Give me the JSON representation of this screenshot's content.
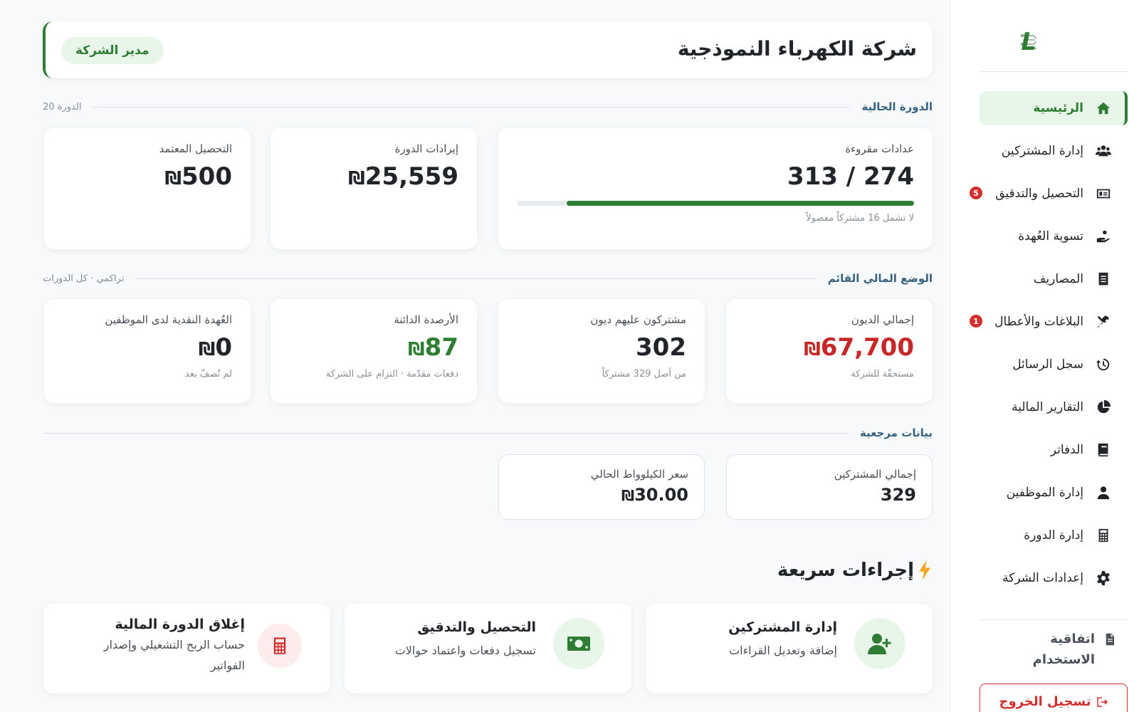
{
  "brand": {
    "logo_text": "PL"
  },
  "sidebar": {
    "items": [
      {
        "label": "الرئيسية",
        "icon": "home-icon",
        "active": true
      },
      {
        "label": "إدارة المشتركين",
        "icon": "users-icon"
      },
      {
        "label": "التحصيل والتدقيق",
        "icon": "money-card-icon",
        "badge": "5"
      },
      {
        "label": "تسوية العُهدة",
        "icon": "hand-coin-icon"
      },
      {
        "label": "المصاريف",
        "icon": "receipt-icon"
      },
      {
        "label": "البلاغات والأعطال",
        "icon": "tools-icon",
        "badge": "1"
      },
      {
        "label": "سجل الرسائل",
        "icon": "history-icon"
      },
      {
        "label": "التقارير المالية",
        "icon": "pie-chart-icon"
      },
      {
        "label": "الدفاتر",
        "icon": "book-icon"
      },
      {
        "label": "إدارة الموظفين",
        "icon": "user-tie-icon"
      },
      {
        "label": "إدارة الدورة",
        "icon": "calculator-icon"
      },
      {
        "label": "إعدادات الشركة",
        "icon": "gear-icon"
      }
    ],
    "terms_label": "اتفاقية الاستخدام",
    "logout_label": "تسجيل الخروج"
  },
  "header": {
    "company_name": "شركة الكهرباء النموذجية",
    "role": "مدير الشركة"
  },
  "current_cycle": {
    "title": "الدورة الحالية",
    "meta": "الدورة 20",
    "meters": {
      "label": "عدادات مقروءة",
      "value": "313 / 274",
      "progress": 0.875,
      "sub": "لا تشمل 16 مشتركاً مفصولاً"
    },
    "revenue": {
      "label": "إيرادات الدورة",
      "value": "25,559",
      "currency": "₪"
    },
    "approved": {
      "label": "التحصيل المعتمد",
      "value": "500",
      "currency": "₪"
    }
  },
  "financial": {
    "title": "الوضع المالي القائم",
    "meta": "تراكمي · كل الدورات",
    "debts": {
      "label": "إجمالي الديون",
      "value": "67,700",
      "currency": "₪",
      "sub": "مستحقّة للشركة"
    },
    "indebted": {
      "label": "مشتركون عليهم ديون",
      "value": "302",
      "sub": "من أصل 329 مشتركاً"
    },
    "credit": {
      "label": "الأرصدة الدائنة",
      "value": "87",
      "currency": "₪",
      "sub": "دفعات مقدّمة · التزام على الشركة"
    },
    "custody": {
      "label": "العُهدة النقدية لدى الموظفين",
      "value": "0",
      "currency": "₪",
      "sub": "لم تُصفّ بعد"
    }
  },
  "reference": {
    "title": "بيانات مرجعية",
    "subscribers": {
      "label": "إجمالي المشتركين",
      "value": "329"
    },
    "kwh": {
      "label": "سعر الكيلوواط الحالي",
      "value": "30.00",
      "currency": "₪"
    }
  },
  "quick_actions": {
    "title": "إجراءات سريعة",
    "items": [
      {
        "title": "إدارة المشتركين",
        "desc": "إضافة وتعديل القراءات",
        "icon": "user-plus-icon"
      },
      {
        "title": "التحصيل والتدقيق",
        "desc": "تسجيل دفعات واعتماد حوالات",
        "icon": "money-bill-icon"
      },
      {
        "title": "إغلاق الدورة المالية",
        "desc": "حساب الربح التشغيلي وإصدار الفواتير",
        "icon": "calculator-icon"
      }
    ]
  },
  "colors": {
    "accent": "#2e7d32",
    "danger": "#c62828",
    "accent_light": "#e8f5e9",
    "section_title": "#37617f"
  }
}
